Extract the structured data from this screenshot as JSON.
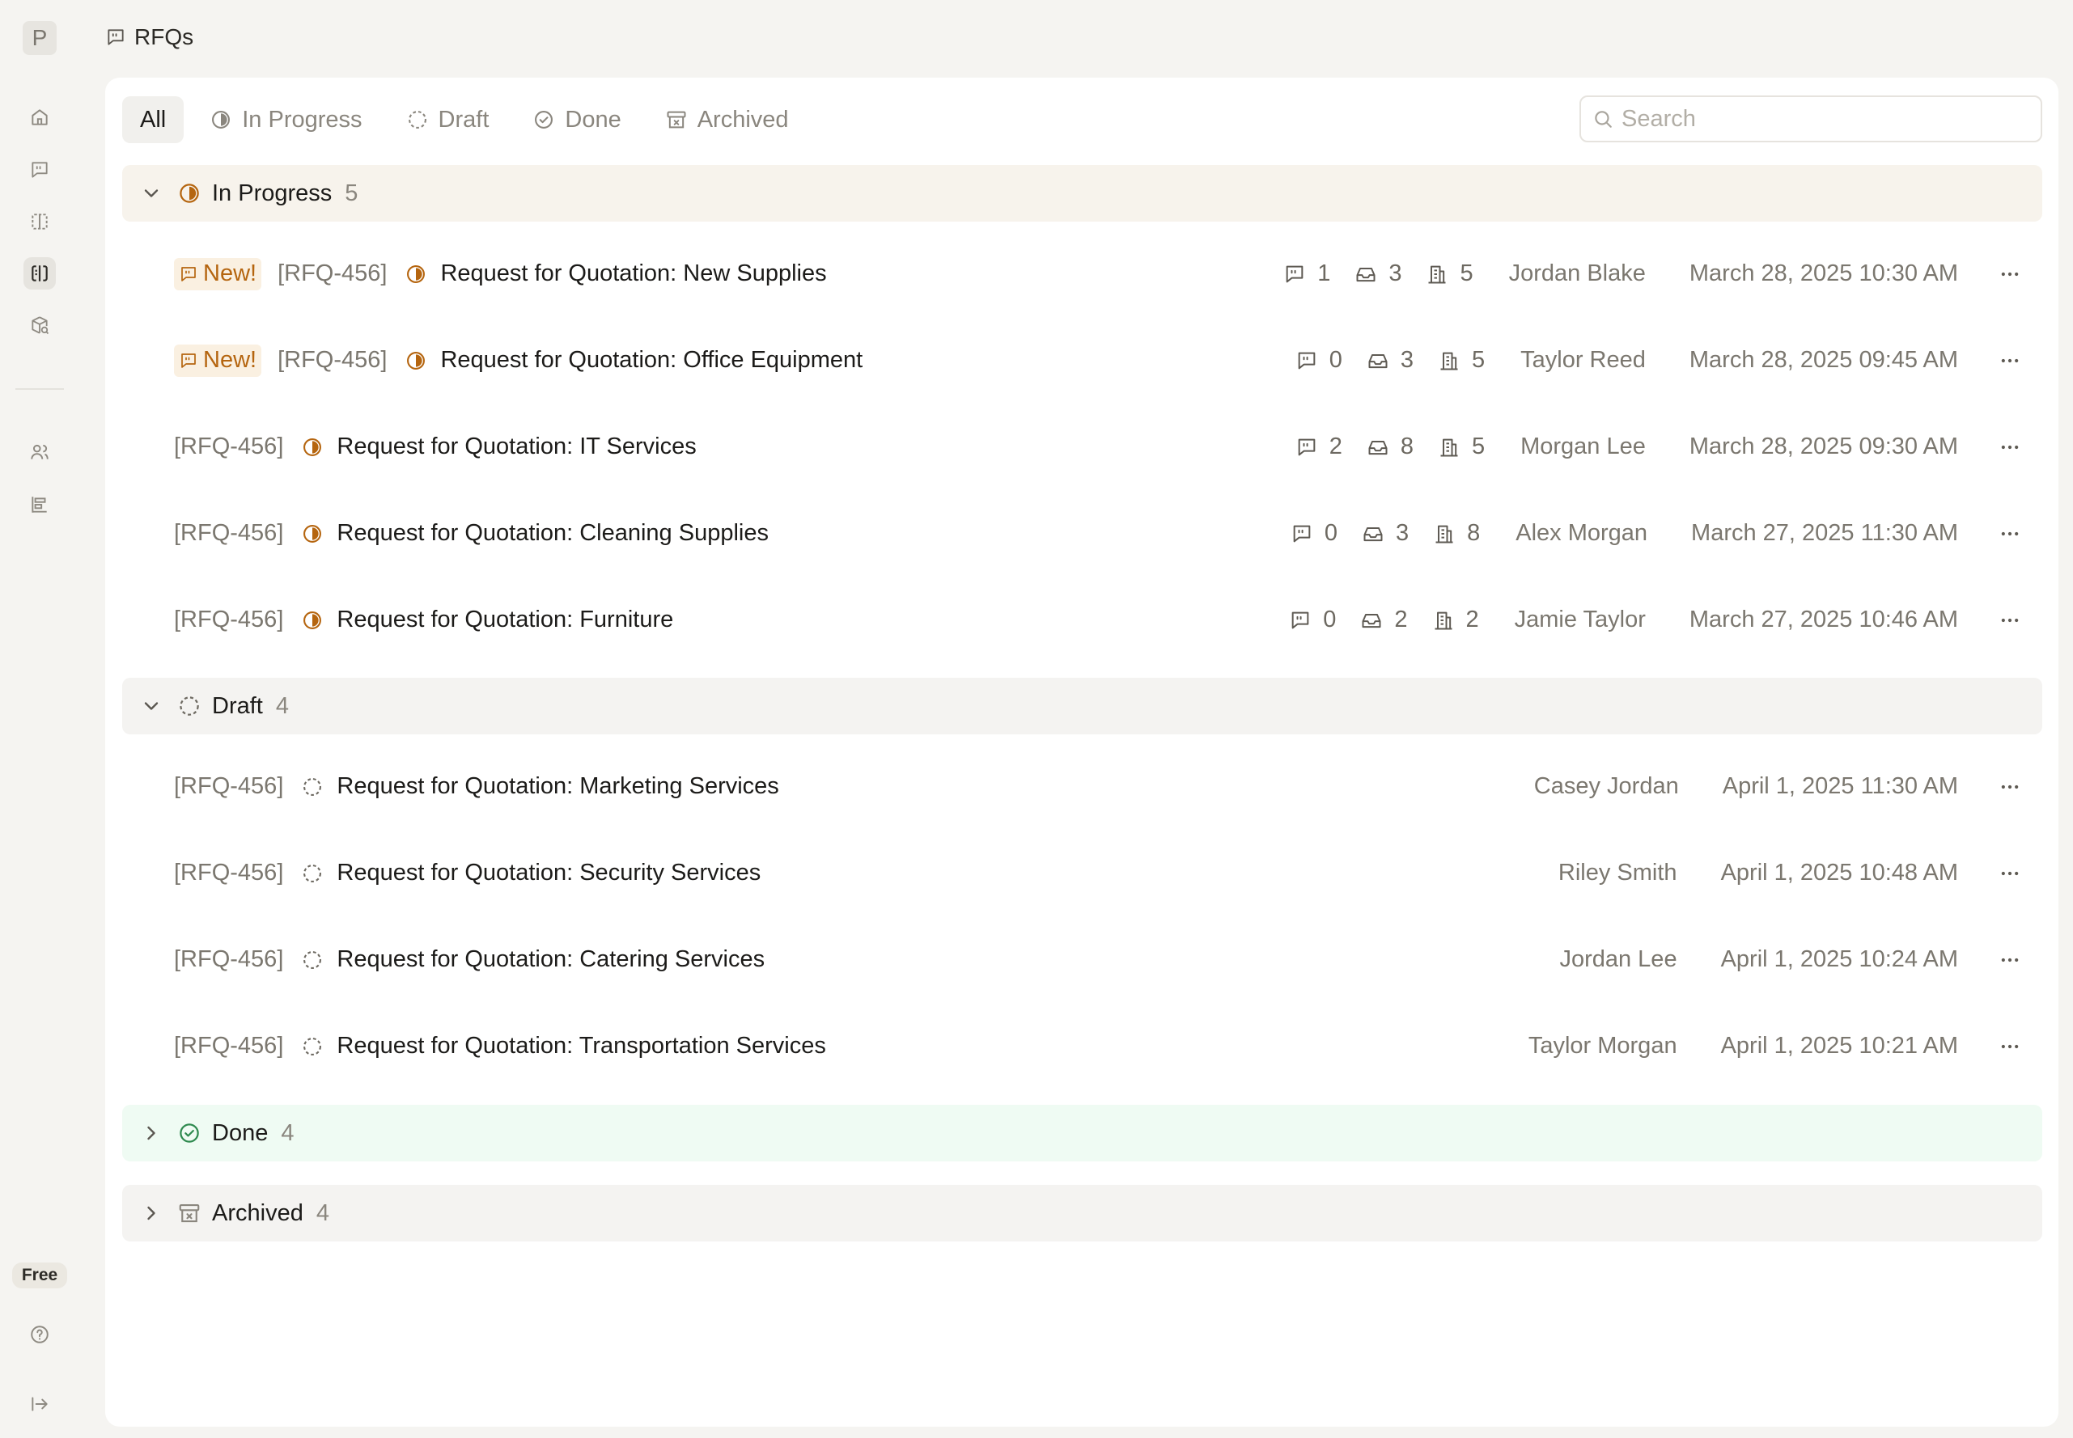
{
  "app": {
    "avatar_letter": "P",
    "plan_badge": "Free"
  },
  "page": {
    "title": "RFQs"
  },
  "tabs": [
    {
      "label": "All",
      "icon": "list-icon"
    },
    {
      "label": "In Progress",
      "icon": "half-circle-icon"
    },
    {
      "label": "Draft",
      "icon": "dashed-circle-icon"
    },
    {
      "label": "Done",
      "icon": "check-circle-icon"
    },
    {
      "label": "Archived",
      "icon": "archive-icon"
    }
  ],
  "search": {
    "placeholder": "Search",
    "value": ""
  },
  "groups": {
    "in_progress": {
      "label": "In Progress",
      "count": "5"
    },
    "draft": {
      "label": "Draft",
      "count": "4"
    },
    "done": {
      "label": "Done",
      "count": "4"
    },
    "archived": {
      "label": "Archived",
      "count": "4"
    }
  },
  "new_badge": "New!",
  "rows": [
    {
      "id": "[RFQ-456]",
      "title": "Request for Quotation: New Supplies",
      "comments": "1",
      "inbox": "3",
      "vendors": "5",
      "owner": "Jordan Blake",
      "date": "March 28, 2025 10:30 AM"
    },
    {
      "id": "[RFQ-456]",
      "title": "Request for Quotation: Office Equipment",
      "comments": "0",
      "inbox": "3",
      "vendors": "5",
      "owner": "Taylor Reed",
      "date": "March 28, 2025 09:45 AM"
    },
    {
      "id": "[RFQ-456]",
      "title": "Request for Quotation: IT Services",
      "comments": "2",
      "inbox": "8",
      "vendors": "5",
      "owner": "Morgan Lee",
      "date": "March 28, 2025 09:30 AM"
    },
    {
      "id": "[RFQ-456]",
      "title": "Request for Quotation: Cleaning Supplies",
      "comments": "0",
      "inbox": "3",
      "vendors": "8",
      "owner": "Alex Morgan",
      "date": "March 27, 2025 11:30 AM"
    },
    {
      "id": "[RFQ-456]",
      "title": "Request for Quotation: Furniture",
      "comments": "0",
      "inbox": "2",
      "vendors": "2",
      "owner": "Jamie Taylor",
      "date": "March 27, 2025 10:46 AM"
    },
    {
      "id": "[RFQ-456]",
      "title": "Request for Quotation: Marketing Services",
      "owner": "Casey Jordan",
      "date": "April 1, 2025 11:30 AM"
    },
    {
      "id": "[RFQ-456]",
      "title": "Request for Quotation: Security Services",
      "owner": "Riley Smith",
      "date": "April 1, 2025 10:48 AM"
    },
    {
      "id": "[RFQ-456]",
      "title": "Request for Quotation: Catering Services",
      "owner": "Jordan Lee",
      "date": "April 1, 2025 10:24 AM"
    },
    {
      "id": "[RFQ-456]",
      "title": "Request for Quotation: Transportation Services",
      "owner": "Taylor Morgan",
      "date": "April 1, 2025 10:21 AM"
    }
  ],
  "colors": {
    "in_progress": "#b5650f",
    "done": "#2f8a4f",
    "muted": "#8a867e"
  }
}
